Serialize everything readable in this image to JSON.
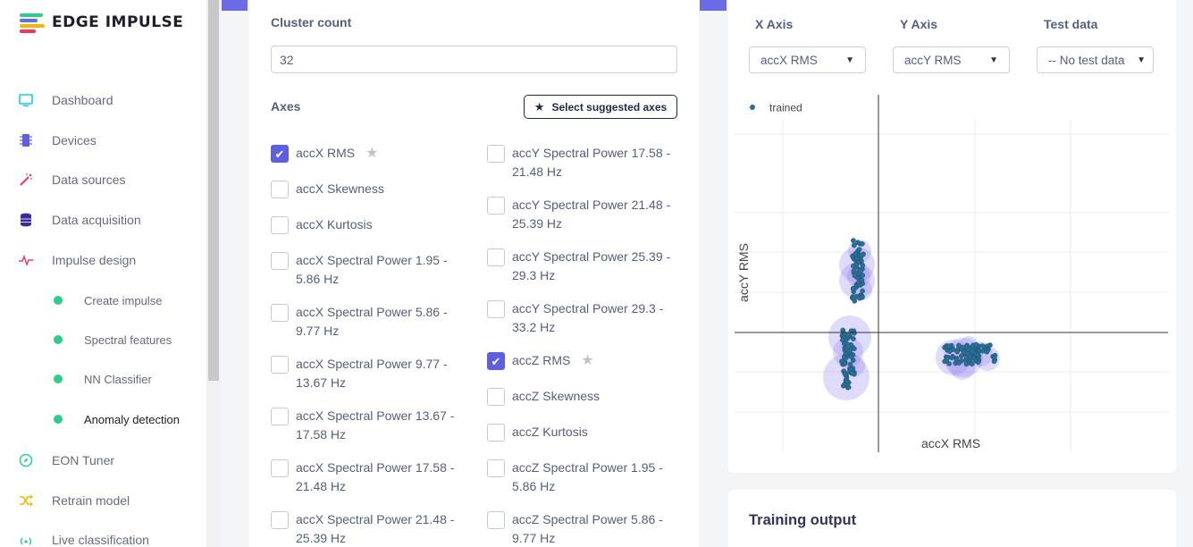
{
  "brand": {
    "name": "EDGE IMPULSE",
    "colors": [
      "#2dce89",
      "#f5b700",
      "#f5365c",
      "#5e72e4"
    ]
  },
  "sidebar": {
    "items": [
      {
        "label": "Dashboard",
        "icon": "monitor-icon",
        "color": "#11cdef"
      },
      {
        "label": "Devices",
        "icon": "chip-icon",
        "color": "#5e5ee0"
      },
      {
        "label": "Data sources",
        "icon": "magic-wand-icon",
        "color": "#f5365c"
      },
      {
        "label": "Data acquisition",
        "icon": "database-icon",
        "color": "#3b2aa0"
      },
      {
        "label": "Impulse design",
        "icon": "pulse-icon",
        "color": "#f5365c"
      }
    ],
    "sub_items": [
      {
        "label": "Create impulse"
      },
      {
        "label": "Spectral features"
      },
      {
        "label": "NN Classifier"
      },
      {
        "label": "Anomaly detection",
        "active": true
      }
    ],
    "bottom_items": [
      {
        "label": "EON Tuner",
        "icon": "compass-icon",
        "color": "#2dce89"
      },
      {
        "label": "Retrain model",
        "icon": "shuffle-icon",
        "color": "#f5b700"
      },
      {
        "label": "Live classification",
        "icon": "signal-icon",
        "color": "#2dce89"
      }
    ]
  },
  "config": {
    "cluster_label": "Cluster count",
    "cluster_value": "32",
    "axes_label": "Axes",
    "suggest_button": "Select suggested axes",
    "axes_left": [
      {
        "label": "accX RMS",
        "checked": true,
        "starred": true
      },
      {
        "label": "accX Skewness",
        "checked": false
      },
      {
        "label": "accX Kurtosis",
        "checked": false
      },
      {
        "label": "accX Spectral Power 1.95 - 5.86 Hz",
        "checked": false
      },
      {
        "label": "accX Spectral Power 5.86 - 9.77 Hz",
        "checked": false
      },
      {
        "label": "accX Spectral Power 9.77 - 13.67 Hz",
        "checked": false
      },
      {
        "label": "accX Spectral Power 13.67 - 17.58 Hz",
        "checked": false
      },
      {
        "label": "accX Spectral Power 17.58 - 21.48 Hz",
        "checked": false
      },
      {
        "label": "accX Spectral Power 21.48 - 25.39 Hz",
        "checked": false
      }
    ],
    "axes_right": [
      {
        "label": "accY Spectral Power 17.58 - 21.48 Hz",
        "checked": false
      },
      {
        "label": "accY Spectral Power 21.48 - 25.39 Hz",
        "checked": false
      },
      {
        "label": "accY Spectral Power 25.39 - 29.3 Hz",
        "checked": false
      },
      {
        "label": "accY Spectral Power 29.3 - 33.2 Hz",
        "checked": false
      },
      {
        "label": "accZ RMS",
        "checked": true,
        "starred": true
      },
      {
        "label": "accZ Skewness",
        "checked": false
      },
      {
        "label": "accZ Kurtosis",
        "checked": false
      },
      {
        "label": "accZ Spectral Power 1.95 - 5.86 Hz",
        "checked": false
      },
      {
        "label": "accZ Spectral Power 5.86 - 9.77 Hz",
        "checked": false
      }
    ]
  },
  "plot_controls": {
    "x_axis_label": "X Axis",
    "x_axis_value": "accX RMS",
    "y_axis_label": "Y Axis",
    "y_axis_value": "accY RMS",
    "test_label": "Test data",
    "test_value": "-- No test data"
  },
  "chart_data": {
    "type": "scatter",
    "xlabel": "accX RMS",
    "ylabel": "accY RMS",
    "legend": "top-left",
    "series": [
      {
        "name": "trained",
        "color": "#2a6f97"
      }
    ],
    "grid": true,
    "cluster_color": "#8c7ff0"
  },
  "training": {
    "title": "Training output"
  }
}
